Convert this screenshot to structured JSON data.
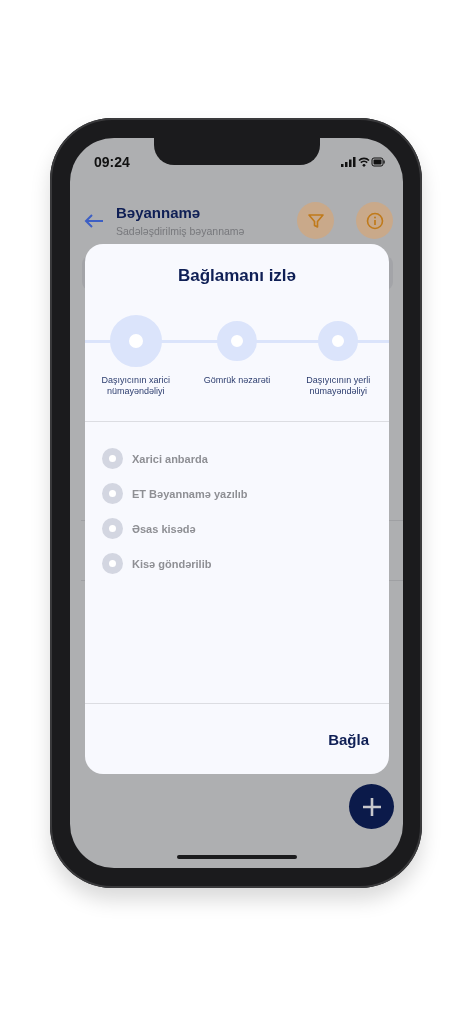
{
  "status_bar": {
    "time": "09:24"
  },
  "header": {
    "title": "Bəyannamə",
    "subtitle": "Sadələşdirilmiş bəyannamə"
  },
  "dialog": {
    "title": "Bağlamanı izlə",
    "steps": [
      {
        "label": "Daşıyıcının xarici nümayəndəliyi",
        "selected": true
      },
      {
        "label": "Gömrük nəzarəti",
        "selected": false
      },
      {
        "label": "Daşıyıcının yerli nümayəndəliyi",
        "selected": false
      }
    ],
    "statuses": [
      {
        "label": "Xarici anbarda",
        "done": false
      },
      {
        "label": "ET Bəyannamə yazılıb",
        "done": false
      },
      {
        "label": "Əsas kisədə",
        "done": false
      },
      {
        "label": "Kisə göndərilib",
        "done": false
      }
    ],
    "close_button": "Bağla"
  }
}
